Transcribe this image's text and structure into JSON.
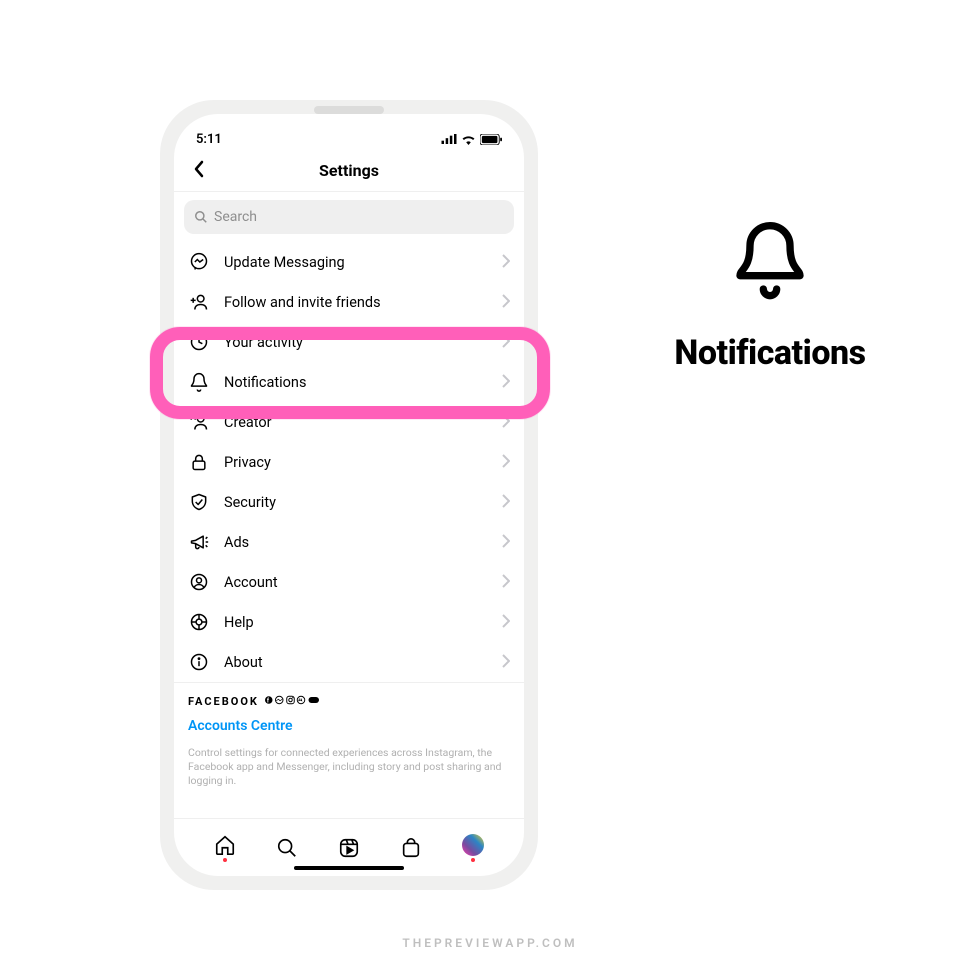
{
  "statusbar": {
    "time": "5:11"
  },
  "navbar": {
    "title": "Settings"
  },
  "search": {
    "placeholder": "Search"
  },
  "rows": {
    "update_messaging": "Update Messaging",
    "follow_invite": "Follow and invite friends",
    "your_activity": "Your activity",
    "notifications": "Notifications",
    "creator": "Creator",
    "privacy": "Privacy",
    "security": "Security",
    "ads": "Ads",
    "account": "Account",
    "help": "Help",
    "about": "About"
  },
  "footer": {
    "brand": "FACEBOOK",
    "accounts_link": "Accounts Centre",
    "description": "Control settings for connected experiences across Instagram, the Facebook app and Messenger, including story and post sharing and logging in."
  },
  "callout": {
    "title": "Notifications"
  },
  "watermark": "THEPREVIEWAPP.COM"
}
